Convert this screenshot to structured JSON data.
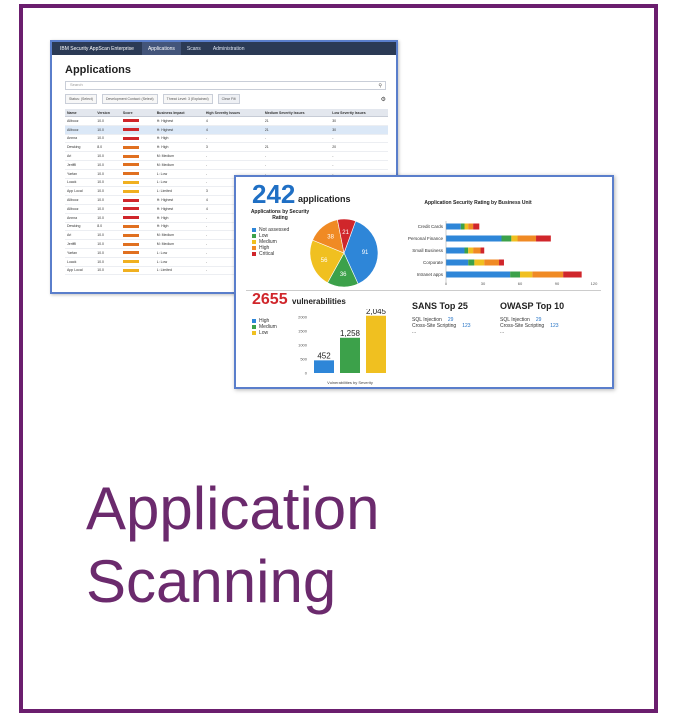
{
  "caption": {
    "line1": "Application",
    "line2": "Scanning"
  },
  "app_window": {
    "brand": "IBM Security AppScan Enterprise",
    "nav": [
      "Applications",
      "Scans",
      "Administration"
    ],
    "title": "Applications",
    "search_placeholder": "Search",
    "filters": [
      "Status: (Select)",
      "Development Contact: (Select)",
      "Threat Level: 3 (Explained)",
      "Clear Filt"
    ],
    "columns": [
      "Name",
      "Version",
      "Score",
      "Business Impact",
      "High Severity Issues",
      "Medium Severity Issues",
      "Low Severity Issues"
    ],
    "rows": [
      [
        "Allbooz",
        "10.0",
        "",
        "H: Highest",
        "4",
        "21",
        "30",
        "#d0262b"
      ],
      [
        "Allbooz",
        "10.0",
        "",
        "H: Highest",
        "4",
        "21",
        "30",
        "#d0262b"
      ],
      [
        "Annna",
        "10.0",
        "",
        "H: High",
        "-",
        "-",
        "-",
        "#d0262b"
      ],
      [
        "Dewking",
        "8.0",
        "",
        "H: High",
        "3",
        "21",
        "20",
        "#e07020"
      ],
      [
        "Ari",
        "10.0",
        "",
        "M: Medium",
        "-",
        "-",
        "-",
        "#e07020"
      ],
      [
        "Jeriffll",
        "10.0",
        "",
        "M: Medium",
        "-",
        "-",
        "-",
        "#e07020"
      ],
      [
        "Yarfan",
        "10.0",
        "",
        "L: Low",
        "-",
        "-",
        "-",
        "#e07020"
      ],
      [
        "Loack",
        "10.0",
        "",
        "L: Low",
        "-",
        "-",
        "-",
        "#f0b020"
      ],
      [
        "App Local",
        "10.0",
        "",
        "L: Limited",
        "3",
        "-",
        "-",
        "#f0b020"
      ],
      [
        "Allbooz",
        "10.0",
        "",
        "H: Highest",
        "4",
        "-",
        "-",
        "#d0262b"
      ],
      [
        "Allbooz",
        "10.0",
        "",
        "H: Highest",
        "4",
        "-",
        "-",
        "#d0262b"
      ],
      [
        "Annna",
        "10.0",
        "",
        "H: High",
        "-",
        "-",
        "-",
        "#d0262b"
      ],
      [
        "Dewking",
        "8.0",
        "",
        "H: High",
        "-",
        "-",
        "-",
        "#e07020"
      ],
      [
        "Ari",
        "10.0",
        "",
        "M: Medium",
        "-",
        "-",
        "-",
        "#e07020"
      ],
      [
        "Jeriffll",
        "10.0",
        "",
        "M: Medium",
        "-",
        "-",
        "-",
        "#e07020"
      ],
      [
        "Yarfan",
        "10.0",
        "",
        "L: Low",
        "-",
        "-",
        "-",
        "#e07020"
      ],
      [
        "Loack",
        "10.0",
        "",
        "L: Low",
        "-",
        "-",
        "-",
        "#f0b020"
      ],
      [
        "App Local",
        "10.0",
        "",
        "L: Limited",
        "-",
        "-",
        "-",
        "#f0b020"
      ]
    ]
  },
  "dashboard": {
    "app_count": "242",
    "app_label": "applications",
    "vuln_count": "2655",
    "vuln_label": "vulnerabilities",
    "sans": {
      "title": "SANS Top 25",
      "rows": [
        [
          "SQL Injection",
          "29"
        ],
        [
          "Cross-Site Scripting",
          "123"
        ],
        [
          "...",
          ""
        ]
      ]
    },
    "owasp": {
      "title": "OWASP Top 10",
      "rows": [
        [
          "SQL Injection",
          "29"
        ],
        [
          "Cross-Site Scripting",
          "123"
        ],
        [
          "...",
          ""
        ]
      ]
    }
  },
  "chart_data": [
    {
      "type": "pie",
      "title": "Applications by Security Rating",
      "categories": [
        "Not assessed",
        "Low",
        "Medium",
        "High",
        "Critical"
      ],
      "values": [
        91,
        36,
        56,
        38,
        21
      ],
      "colors": [
        "#2e86d8",
        "#3ca14a",
        "#f0c020",
        "#f08a24",
        "#d0262b"
      ],
      "legend": "left"
    },
    {
      "type": "bar",
      "orientation": "horizontal",
      "stacked": true,
      "title": "Application Security Rating by Business Unit",
      "categories": [
        "Credit Cards",
        "Personal Finance",
        "Small Business",
        "Corporate",
        "Intranet apps"
      ],
      "series": [
        {
          "color": "#2e86d8",
          "values": [
            12,
            45,
            15,
            18,
            52
          ]
        },
        {
          "color": "#3ca14a",
          "values": [
            3,
            8,
            3,
            5,
            8
          ]
        },
        {
          "color": "#f0c020",
          "values": [
            3,
            5,
            4,
            8,
            10
          ]
        },
        {
          "color": "#f08a24",
          "values": [
            4,
            15,
            6,
            12,
            25
          ]
        },
        {
          "color": "#d0262b",
          "values": [
            5,
            12,
            3,
            4,
            15
          ]
        }
      ],
      "xticks": [
        "0",
        "30",
        "60",
        "90",
        "120"
      ],
      "xlim": [
        0,
        120
      ]
    },
    {
      "type": "bar",
      "title": "",
      "xlabel": "Vulnerabilities by Severity",
      "categories": [
        "High",
        "Medium",
        "Low"
      ],
      "values": [
        452,
        1258,
        2045
      ],
      "colors": [
        "#2e86d8",
        "#3ca14a",
        "#f0c020"
      ],
      "yticks": [
        "0",
        "500",
        "1000",
        "1500",
        "2000"
      ],
      "ylim": [
        0,
        2000
      ]
    }
  ]
}
